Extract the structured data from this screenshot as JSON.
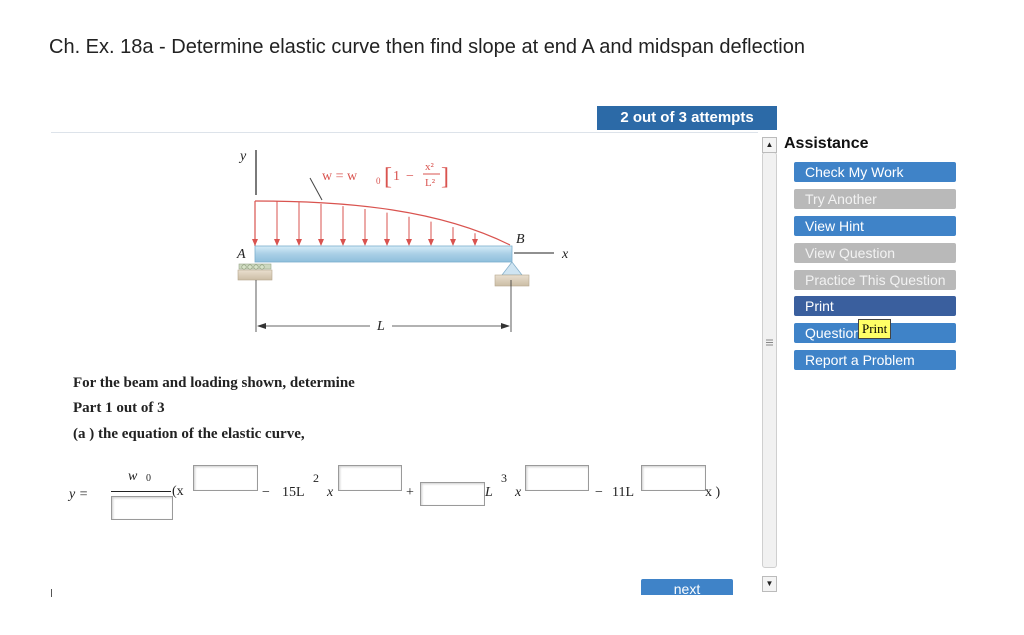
{
  "page": {
    "title": "Ch. Ex. 18a - Determine elastic curve then find slope at end A and midspan deflection",
    "attempts": "2 out of 3 attempts"
  },
  "figure": {
    "y_axis": "y",
    "x_axis": "x",
    "point_a": "A",
    "point_b": "B",
    "span": "L",
    "load_lhs": "w = w",
    "load_sub": "0",
    "load_bracket_open": "[",
    "load_one": "1",
    "load_minus": "−",
    "load_num": "x²",
    "load_den": "L²",
    "load_bracket_close": "]"
  },
  "problem": {
    "intro": "For the beam and loading shown, determine",
    "part": "Part 1 out of 3",
    "question": "(a ) the equation of the elastic curve,"
  },
  "answer": {
    "y_label": "y =",
    "w_label": "w",
    "w_sub": "0",
    "open_paren": "(x",
    "minus1": "−",
    "coef_15L": "15L",
    "exp_2": "2",
    "x_term1": "x",
    "plus": "+",
    "L_term": "L",
    "exp_3": "3",
    "x_term2": "x",
    "minus2": "−",
    "coef_11L": "11L",
    "close": "x )"
  },
  "navigation": {
    "next_label": "next"
  },
  "assistance": {
    "title": "Assistance",
    "items": [
      {
        "label": "Check My Work",
        "state": "active"
      },
      {
        "label": "Try Another",
        "state": "disabled"
      },
      {
        "label": "View Hint",
        "state": "active"
      },
      {
        "label": "View Question",
        "state": "disabled"
      },
      {
        "label": "Practice This Question",
        "state": "disabled"
      },
      {
        "label": "Print",
        "state": "active"
      },
      {
        "label": "Question",
        "state": "active"
      },
      {
        "label": "Report a Problem",
        "state": "active"
      }
    ]
  },
  "tooltip": {
    "label": "Print"
  },
  "colors": {
    "accent": "#3f83c8",
    "header_bar": "#2c6aa7",
    "disabled": "#b9b9b9",
    "load_arrows": "#d9534f",
    "beam": "#a9cfe6",
    "tooltip_bg": "#ffff66"
  },
  "icons": {
    "scroll_up": "triangle-up-icon",
    "scroll_down": "triangle-down-icon",
    "scroll_grip": "grip-icon"
  }
}
